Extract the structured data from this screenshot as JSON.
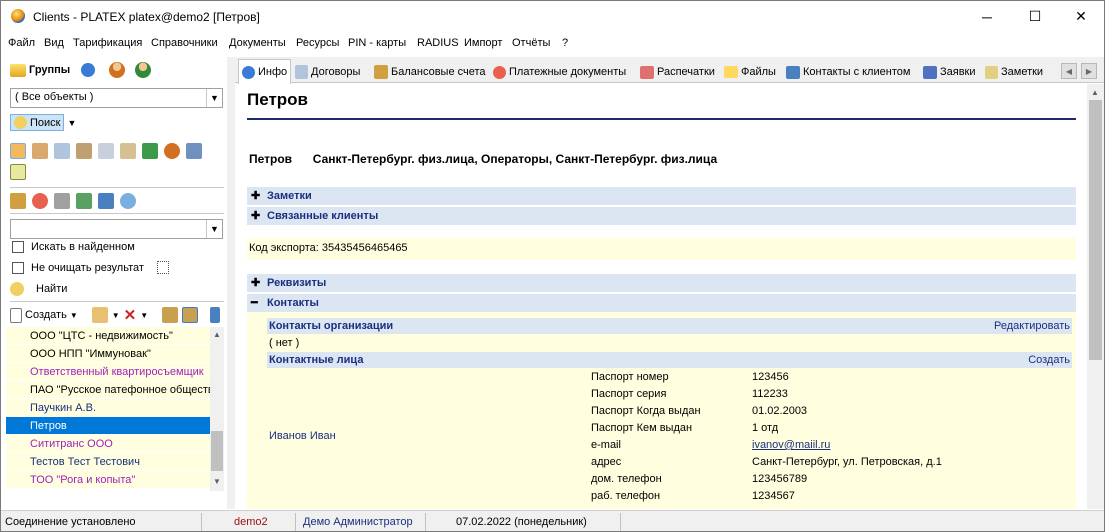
{
  "window": {
    "title": "Clients - PLATEX platex@demo2 [Петров]",
    "controls": {
      "minimize": "─",
      "maximize": "☐",
      "close": "✕"
    }
  },
  "menu": [
    "Файл",
    "Вид",
    "Тарификация",
    "Справочники",
    "Документы",
    "Ресурсы",
    "PIN - карты",
    "RADIUS",
    "Импорт",
    "Отчёты",
    "?"
  ],
  "left": {
    "groups_label": "Группы",
    "objects_combo": "( Все объекты )",
    "search_label": "Поиск",
    "search_combo": "",
    "search_in_found": "Искать в найденном",
    "keep_results": "Не очищать результат",
    "find_button": "Найти",
    "create_button": "Создать",
    "clients": [
      {
        "name": "ООО \"ЦТС - недвижимость\"",
        "color": "#000000"
      },
      {
        "name": "ООО НПП \"Иммуновак\"",
        "color": "#000000"
      },
      {
        "name": "Ответственный квартиросъемщик",
        "color": "#a020c0"
      },
      {
        "name": "ПАО \"Русское патефонное общество\"",
        "color": "#000000"
      },
      {
        "name": "Паучкин А.В.",
        "color": "#1a2f80"
      },
      {
        "name": "Петров",
        "color": "#ffffff",
        "selected": true
      },
      {
        "name": "Сититранс ООО",
        "color": "#a020c0"
      },
      {
        "name": "Тестов Тест Тестович",
        "color": "#1a2f80"
      },
      {
        "name": "ТОО \"Рога и копыта\"",
        "color": "#a020c0"
      }
    ]
  },
  "tabs": [
    "Инфо",
    "Договоры",
    "Балансовые счета",
    "Платежные документы",
    "Распечатки",
    "Файлы",
    "Контакты с клиентом",
    "Заявки",
    "Заметки"
  ],
  "info": {
    "heading": "Петров",
    "client_name": "Петров",
    "client_groups": "Санкт-Петербург. физ.лица, Операторы, Санкт-Петербург. физ.лица",
    "notes_label": "Заметки",
    "related_label": "Связанные клиенты",
    "export_code": "Код экспорта: 35435456465465",
    "requisites_label": "Реквизиты",
    "contacts_label": "Контакты",
    "org_contacts_label": "Контакты организации",
    "edit_link": "Редактировать",
    "org_contacts_value": "( нет )",
    "contact_persons_label": "Контактные лица",
    "create_link": "Создать",
    "person_name": "Иванов Иван",
    "person_fields": [
      {
        "k": "Паспорт номер",
        "v": "123456"
      },
      {
        "k": "Паспорт серия",
        "v": "112233"
      },
      {
        "k": "Паспорт Когда выдан",
        "v": "01.02.2003"
      },
      {
        "k": "Паспорт Кем выдан",
        "v": "1 отд"
      },
      {
        "k": "e-mail",
        "v": "ivanov@maiil.ru",
        "link": true
      },
      {
        "k": "адрес",
        "v": "Санкт-Петербург, ул. Петровская, д.1"
      },
      {
        "k": "дом. телефон",
        "v": "123456789"
      },
      {
        "k": "раб. телефон",
        "v": "1234567"
      }
    ]
  },
  "status": {
    "connection": "Соединение установлено",
    "server": "demo2",
    "user": "Демо Администратор",
    "date": "07.02.2022 (понедельник)"
  }
}
